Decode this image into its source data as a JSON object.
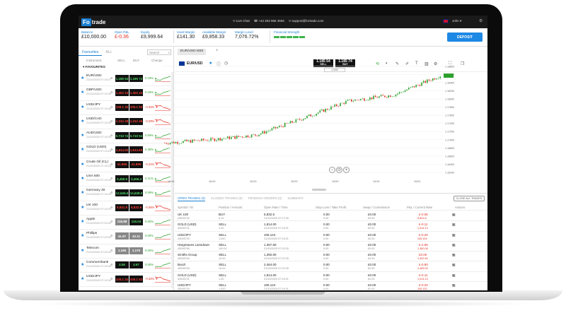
{
  "topbar": {
    "logo_box": "Fo",
    "logo_rest": "trade",
    "live_chat": "Live Chat",
    "phone": "+44 203 966 4506",
    "email": "support@fortrade.com",
    "user": "John"
  },
  "account": {
    "balance_label": "Balance",
    "balance": "£10,000.00",
    "open_pl_label": "Open P&L",
    "open_pl": "£-0.36",
    "equity_label": "Equity",
    "equity": "£9,999.64",
    "used_margin_label": "Used Margin",
    "used_margin": "£141.30",
    "available_margin_label": "Available Margin",
    "available_margin": "£9,858.33",
    "margin_level_label": "Margin Level",
    "margin_level": "7,076.72%",
    "strength_label": "Financial Strength",
    "deposit": "DEPOSIT"
  },
  "watchlist": {
    "tab_favourites": "Favourites",
    "tab_all": "ALL",
    "search_placeholder": "Search",
    "col_instrument": "Instrument",
    "col_sell": "SELL",
    "col_buy": "BUY",
    "col_change": "Change",
    "section": "FAVOURITES",
    "rows": [
      {
        "sym": "EUR/USD",
        "time": "21/10/2020 07:19:27",
        "sell": "1.185 54",
        "buy": "1.185 74",
        "sell_c": "green",
        "buy_c": "green",
        "chg": "0.23% ▲",
        "chg_c": "green"
      },
      {
        "sym": "GBP/USD",
        "time": "21/10/2020 07:19:26",
        "sell": "1.302 22",
        "buy": "1.302 42",
        "sell_c": "red",
        "buy_c": "red",
        "chg": "0.16% ▲",
        "chg_c": "green"
      },
      {
        "sym": "USD/JPY",
        "time": "21/10/2020 07:19:26",
        "sell": "105.1 32",
        "buy": "105.1 52",
        "sell_c": "red",
        "buy_c": "red",
        "chg": "-0.32% ▼",
        "chg_c": "red"
      },
      {
        "sym": "USD/CAD",
        "time": "21/10/2020 07:19:25",
        "sell": "1.312 28",
        "buy": "1.312 48",
        "sell_c": "red",
        "buy_c": "red",
        "chg": "-0.29% ▼",
        "chg_c": "red"
      },
      {
        "sym": "AUD/USD",
        "time": "21/10/2020 07:19:25",
        "sell": "0.710 74",
        "buy": "0.710 94",
        "sell_c": "green",
        "buy_c": "green",
        "chg": "0.59% ▲",
        "chg_c": "green"
      },
      {
        "sym": "GOLD (USD)",
        "time": "21/10/2020 07:19:25",
        "sell": "1,914.00",
        "buy": "1,914.60",
        "sell_c": "red",
        "buy_c": "red",
        "chg": "0.36% ▲",
        "chg_c": "green"
      },
      {
        "sym": "Crude Oil (CL)",
        "time": "21/10/2020 07:19:24",
        "sell": "41.865",
        "buy": "41.895",
        "sell_c": "red",
        "buy_c": "red",
        "chg": "-0.21% ▼",
        "chg_c": "red"
      },
      {
        "sym": "USA 500",
        "time": "21/10/2020 07:19:24",
        "sell": "3,455.9",
        "buy": "3,456.3",
        "sell_c": "green",
        "buy_c": "green",
        "chg": "0.11% ▲",
        "chg_c": "green"
      },
      {
        "sym": "Germany 30",
        "time": "21/10/2020 07:19:23",
        "sell": "12,626.5",
        "buy": "12,628.0",
        "sell_c": "green",
        "buy_c": "green",
        "chg": "0.09% ▲",
        "chg_c": "green"
      },
      {
        "sym": "UK 100",
        "time": "21/10/2020 07:19:23",
        "sell": "5,831.8",
        "buy": "5,832.9",
        "sell_c": "red",
        "buy_c": "red",
        "chg": "-0.06% ▼",
        "chg_c": "red"
      },
      {
        "sym": "Apple",
        "time": "21/10/2020 07:20:00",
        "sell": "115.98",
        "buy": "116.04",
        "sell_c": "gray",
        "buy_c": "green",
        "chg": "0.00%",
        "chg_c": "green"
      },
      {
        "sym": "Phillips",
        "time": "21/10/2020 07:20:00",
        "sell": "41.97",
        "buy": "42.11",
        "sell_c": "gray",
        "buy_c": "gray",
        "chg": "0.00%",
        "chg_c": "green"
      },
      {
        "sym": "Telecom",
        "time": "21/10/2020 07:20:00",
        "sell": "1.165",
        "buy": "1.170",
        "sell_c": "gray",
        "buy_c": "gray",
        "chg": "0.00%",
        "chg_c": "green"
      },
      {
        "sym": "Commerzbank",
        "time": "21/10/2020 07:20:00",
        "sell": "4.56",
        "buy": "4.67",
        "sell_c": "green",
        "buy_c": "green",
        "chg": "0.00%",
        "chg_c": "green"
      },
      {
        "sym": "USD/JPY",
        "time": "21/10/2020 07:19:26",
        "sell": "105.1 32",
        "buy": "105.1 52",
        "sell_c": "red",
        "buy_c": "red",
        "chg": "-0.32% ▼",
        "chg_c": "red"
      }
    ]
  },
  "chart": {
    "tab": "EUR/USD M30",
    "symbol": "EUR/USD",
    "sell_price": "1.185 54",
    "sell_label": "SELL",
    "buy_price": "1.185 74",
    "buy_label": "BUY",
    "qty": "1,000",
    "y_ticks": [
      "1.18800",
      "1.18600",
      "1.18400",
      "1.18200",
      "1.18000",
      "1.17800",
      "1.17600",
      "1.17400",
      "1.17200",
      "1.17000",
      "1.16800",
      "1.16600",
      "1.16400",
      "1.16200"
    ],
    "x_ticks": [
      "10/16",
      "16:00",
      "10/19",
      "15:00",
      "10/20",
      "14:00",
      "10/21"
    ]
  },
  "chart_data": {
    "type": "line",
    "title": "",
    "xlabel": "",
    "ylabel": "",
    "x": [
      "10/16",
      "16:00",
      "10/19",
      "15:00",
      "10/20",
      "14:00",
      "10/21"
    ],
    "series": [
      {
        "values": [
          1.1692,
          1.17,
          1.1712,
          1.1752,
          1.1795,
          1.181,
          1.1857
        ]
      }
    ],
    "ylim": [
      1.162,
      1.189
    ]
  },
  "trades": {
    "tab_open": "OPEN TRADES (3)",
    "tab_closed": "CLOSED TRADES (0)",
    "tab_pending": "PENDING ORDERS (0)",
    "tab_summary": "SUMMARY",
    "close_all": "CLOSE ALL TRADES",
    "head": {
      "symbol": "Symbol / ID",
      "position": "Position / Amount",
      "open": "Open Rate / Time",
      "stop": "Stop Loss / Take Profit",
      "swap": "Swap / Commission",
      "pl": "P&L / Current Rate",
      "actions": "Actions"
    },
    "rows": [
      {
        "sym": "UK 100",
        "id": "43006742",
        "pos": "BUY",
        "amt": "0.10",
        "rate": "5,832.5",
        "time": "21/10/2020 07:17:25",
        "sl": "0.00",
        "tp": "0.00",
        "swap": "£0.00",
        "comm": "£0.00",
        "pl": "£-0.05",
        "cur": "5,831.8"
      },
      {
        "sym": "GOLD (USD)",
        "id": "43006741",
        "pos": "SELL",
        "amt": "1.00",
        "rate": "1,914.00",
        "time": "21/10/2020 07:19:21",
        "sl": "0.00",
        "tp": "0.00",
        "swap": "£0.00",
        "comm": "£0.00",
        "pl": "£-0.11",
        "cur": "1,914.14"
      },
      {
        "sym": "USD/JPY",
        "id": "43006740",
        "pos": "SELL",
        "amt": "1,000",
        "rate": "105.124",
        "time": "21/10/2020 07:19:21",
        "sl": "0.00",
        "tp": "0.00",
        "swap": "£0.00",
        "comm": "£0.00",
        "pl": "£-0.20",
        "cur": "105.152"
      },
      {
        "sym": "Hargreaves Lansdown",
        "id": "43006765",
        "pos": "SELL",
        "amt": "100.00",
        "rate": "1,357.50",
        "time": "21/10/2020 07:22:25",
        "sl": "0.00",
        "tp": "0.00",
        "swap": "£0.00",
        "comm": "£0.00",
        "pl": "£-2.56",
        "cur": "1,360.06"
      },
      {
        "sym": "Smiths Group",
        "id": "43006764",
        "pos": "SELL",
        "amt": "10.00",
        "rate": "1,392.00",
        "time": "21/10/2020 07:22:25",
        "sl": "0.00",
        "tp": "0.00",
        "swap": "£0.00",
        "comm": "£0.00",
        "pl": "£0.00",
        "cur": "1,392.50"
      },
      {
        "sym": "Bunzl",
        "id": "43006763",
        "pos": "SELL",
        "amt": "10.00",
        "rate": "2,464.00",
        "time": "21/10/2020 07:22:25",
        "sl": "0.00",
        "tp": "0.00",
        "swap": "£0.00",
        "comm": "£0.00",
        "pl": "£-0.90",
        "cur": "2,465.00"
      },
      {
        "sym": "GOLD (USD)",
        "id": "43006741",
        "pos": "SELL",
        "amt": "1.00",
        "rate": "1,914.00",
        "time": "21/10/2020 07:19:21",
        "sl": "0.00",
        "tp": "0.00",
        "swap": "£0.00",
        "comm": "£0.00",
        "pl": "£-0.11",
        "cur": "1,914.14"
      },
      {
        "sym": "USD/JPY",
        "id": "43006740",
        "pos": "SELL",
        "amt": "1,000",
        "rate": "105.124",
        "time": "21/10/2020 07:19:21",
        "sl": "0.00",
        "tp": "0.00",
        "swap": "£0.00",
        "comm": "£0.00",
        "pl": "£-0.20",
        "cur": "105.152"
      }
    ]
  }
}
